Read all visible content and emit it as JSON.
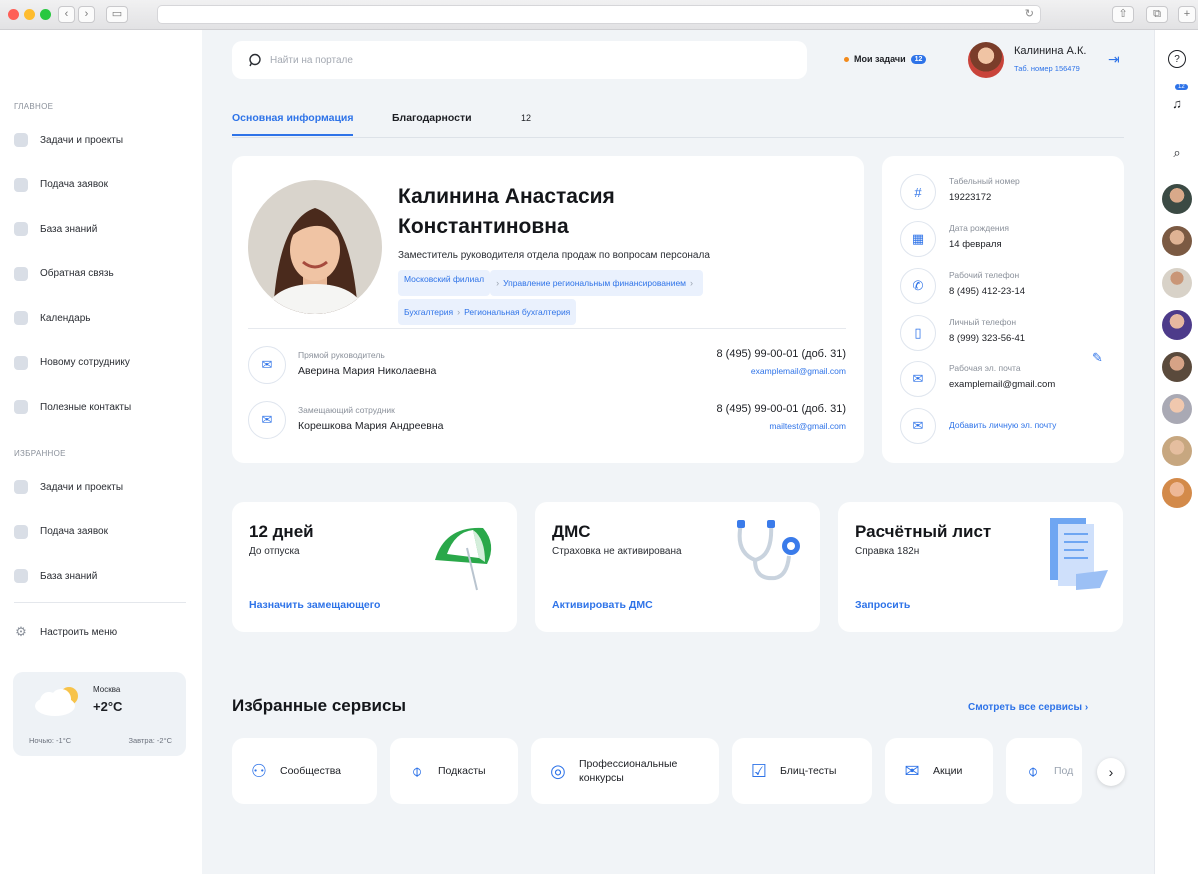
{
  "colors": {
    "accent": "#2e73e8",
    "orange": "#f28a1b",
    "bg": "#f1f4f7"
  },
  "search": {
    "placeholder": "Найти на портале"
  },
  "header": {
    "tasks_label": "Мои задачи",
    "tasks_count": "12",
    "user_name": "Калинина А.К.",
    "user_tab": "Таб. номер 156479"
  },
  "tabs": [
    {
      "label": "Основная информация",
      "active": true
    },
    {
      "label": "Благодарности",
      "count": "12"
    }
  ],
  "sidebar": {
    "main_title": "ГЛАВНОЕ",
    "main_items": [
      {
        "label": "Задачи и проекты",
        "icon": "tasks-icon"
      },
      {
        "label": "Подача заявок",
        "icon": "users-icon"
      },
      {
        "label": "База знаний",
        "icon": "info-icon"
      },
      {
        "label": "Обратная связь",
        "icon": "feedback-icon"
      },
      {
        "label": "Календарь",
        "icon": "calendar-icon"
      },
      {
        "label": "Новому сотруднику",
        "icon": "document-icon"
      },
      {
        "label": "Полезные контакты",
        "icon": "contacts-icon"
      }
    ],
    "fav_title": "ИЗБРАННОЕ",
    "fav_items": [
      {
        "label": "Задачи и проекты",
        "icon": "tasks-icon"
      },
      {
        "label": "Подача заявок",
        "icon": "users-icon"
      },
      {
        "label": "База знаний",
        "icon": "info-icon"
      }
    ],
    "settings_label": "Настроить меню"
  },
  "weather": {
    "city": "Москва",
    "temp": "+2°C",
    "night": "Ночью: -1°C",
    "tomorrow": "Завтра: -2°C"
  },
  "profile": {
    "name_line1": "Калинина Анастасия",
    "name_line2": "Константиновна",
    "position": "Заместитель руководителя отдела продаж по вопросам персонала",
    "crumbs_row1": [
      "Московский филиал",
      "Управление региональным финансированием"
    ],
    "crumbs_row2": [
      "Бухгалтерия",
      "Региональная бухгалтерия"
    ],
    "people": [
      {
        "role": "Прямой руководитель",
        "name": "Аверина Мария Николаевна",
        "phone": "8 (495) 99-00-01 (доб. 31)",
        "email": "examplemail@gmail.com"
      },
      {
        "role": "Замещающий сотрудник",
        "name": "Корешкова Мария Андреевна",
        "phone": "8 (495) 99-00-01 (доб. 31)",
        "email": "mailtest@gmail.com"
      }
    ]
  },
  "contacts": [
    {
      "label": "Табельный номер",
      "value": "19223172",
      "icon": "hash-icon"
    },
    {
      "label": "Дата рождения",
      "value": "14 февраля",
      "icon": "calendar-icon"
    },
    {
      "label": "Рабочий телефон",
      "value": "8 (495) 412-23-14",
      "icon": "phone-icon"
    },
    {
      "label": "Личный телефон",
      "value": "8 (999) 323-56-41",
      "icon": "mobile-icon"
    },
    {
      "label": "Рабочая эл. почта",
      "value": "examplemail@gmail.com",
      "icon": "mail-icon"
    }
  ],
  "add_email": "Добавить личную эл. почту",
  "widgets": [
    {
      "title": "12 дней",
      "subtitle": "До отпуска",
      "action": "Назначить замещающего",
      "icon": "umbrella-icon"
    },
    {
      "title": "ДМС",
      "subtitle": "Страховка не активирована",
      "action": "Активировать ДМС",
      "icon": "stethoscope-icon"
    },
    {
      "title": "Расчётный лист",
      "subtitle": "Справка 182н",
      "action": "Запросить",
      "icon": "receipt-icon"
    }
  ],
  "services": {
    "title": "Избранные сервисы",
    "all_label": "Смотреть все сервисы",
    "items": [
      {
        "label": "Сообщества",
        "icon": "community-icon"
      },
      {
        "label": "Подкасты",
        "icon": "microphone-icon"
      },
      {
        "label": "Профессиональные конкурсы",
        "icon": "award-icon"
      },
      {
        "label": "Блиц-тесты",
        "icon": "checklist-icon"
      },
      {
        "label": "Акции",
        "icon": "ticket-icon"
      },
      {
        "label": "Под",
        "icon": "microphone-icon"
      }
    ]
  },
  "rail": {
    "notify_count": "12"
  }
}
